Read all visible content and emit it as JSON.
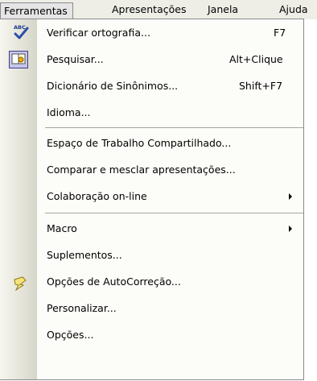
{
  "menubar": {
    "items": [
      {
        "label": "Ferramentas"
      },
      {
        "label": "Apresentações"
      },
      {
        "label": "Janela"
      },
      {
        "label": "Ajuda"
      }
    ]
  },
  "menu": {
    "items": [
      {
        "label": "Verificar ortografia...",
        "shortcut": "F7",
        "icon": "spellcheck-icon"
      },
      {
        "label": "Pesquisar...",
        "shortcut": "Alt+Clique",
        "icon": "research-icon"
      },
      {
        "label": "Dicionário de Sinônimos...",
        "shortcut": "Shift+F7"
      },
      {
        "label": "Idioma..."
      },
      {
        "label": "Espaço de Trabalho Compartilhado..."
      },
      {
        "label": "Comparar e mesclar apresentações..."
      },
      {
        "label": "Colaboração on-line",
        "submenu": true
      },
      {
        "label": "Macro",
        "submenu": true
      },
      {
        "label": "Suplementos..."
      },
      {
        "label": "Opções de AutoCorreção...",
        "icon": "autocorrect-icon"
      },
      {
        "label": "Personalizar..."
      },
      {
        "label": "Opções..."
      }
    ]
  },
  "colors": {
    "menubar_bg": "#eeeee7",
    "menu_bg": "#fcfcf9",
    "border": "#8a8a8a",
    "separator": "#a7a69a"
  }
}
